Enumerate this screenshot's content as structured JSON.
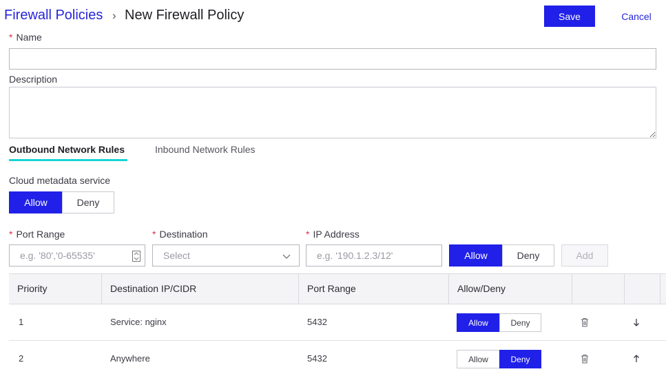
{
  "header": {
    "breadcrumb_parent": "Firewall Policies",
    "breadcrumb_separator": "›",
    "breadcrumb_current": "New Firewall Policy",
    "save_label": "Save",
    "cancel_label": "Cancel"
  },
  "form": {
    "name_label": "Name",
    "name_value": "",
    "required_marker": "*",
    "description_label": "Description",
    "description_value": ""
  },
  "tabs": [
    {
      "label": "Outbound Network Rules",
      "active": true
    },
    {
      "label": "Inbound Network Rules",
      "active": false
    }
  ],
  "metadata_service": {
    "label": "Cloud metadata service",
    "allow_label": "Allow",
    "deny_label": "Deny",
    "selected": "Allow"
  },
  "new_rule": {
    "port_range_label": "Port Range",
    "port_range_placeholder": "e.g. '80','0-65535'",
    "destination_label": "Destination",
    "destination_placeholder": "Select",
    "ip_label": "IP Address",
    "ip_placeholder": "e.g. '190.1.2.3/12'",
    "allow_label": "Allow",
    "deny_label": "Deny",
    "selected": "Allow",
    "add_label": "Add"
  },
  "table": {
    "headers": [
      "Priority",
      "Destination IP/CIDR",
      "Port Range",
      "Allow/Deny"
    ],
    "rows": [
      {
        "priority": "1",
        "destination": "Service: nginx",
        "port_range": "5432",
        "allow_label": "Allow",
        "deny_label": "Deny",
        "selected": "Allow",
        "move": "down"
      },
      {
        "priority": "2",
        "destination": "Anywhere",
        "port_range": "5432",
        "allow_label": "Allow",
        "deny_label": "Deny",
        "selected": "Deny",
        "move": "up"
      }
    ]
  },
  "colors": {
    "primary": "#2020e8",
    "link": "#2626d9",
    "tab_underline": "#17d4d4",
    "required": "#d9304a"
  }
}
